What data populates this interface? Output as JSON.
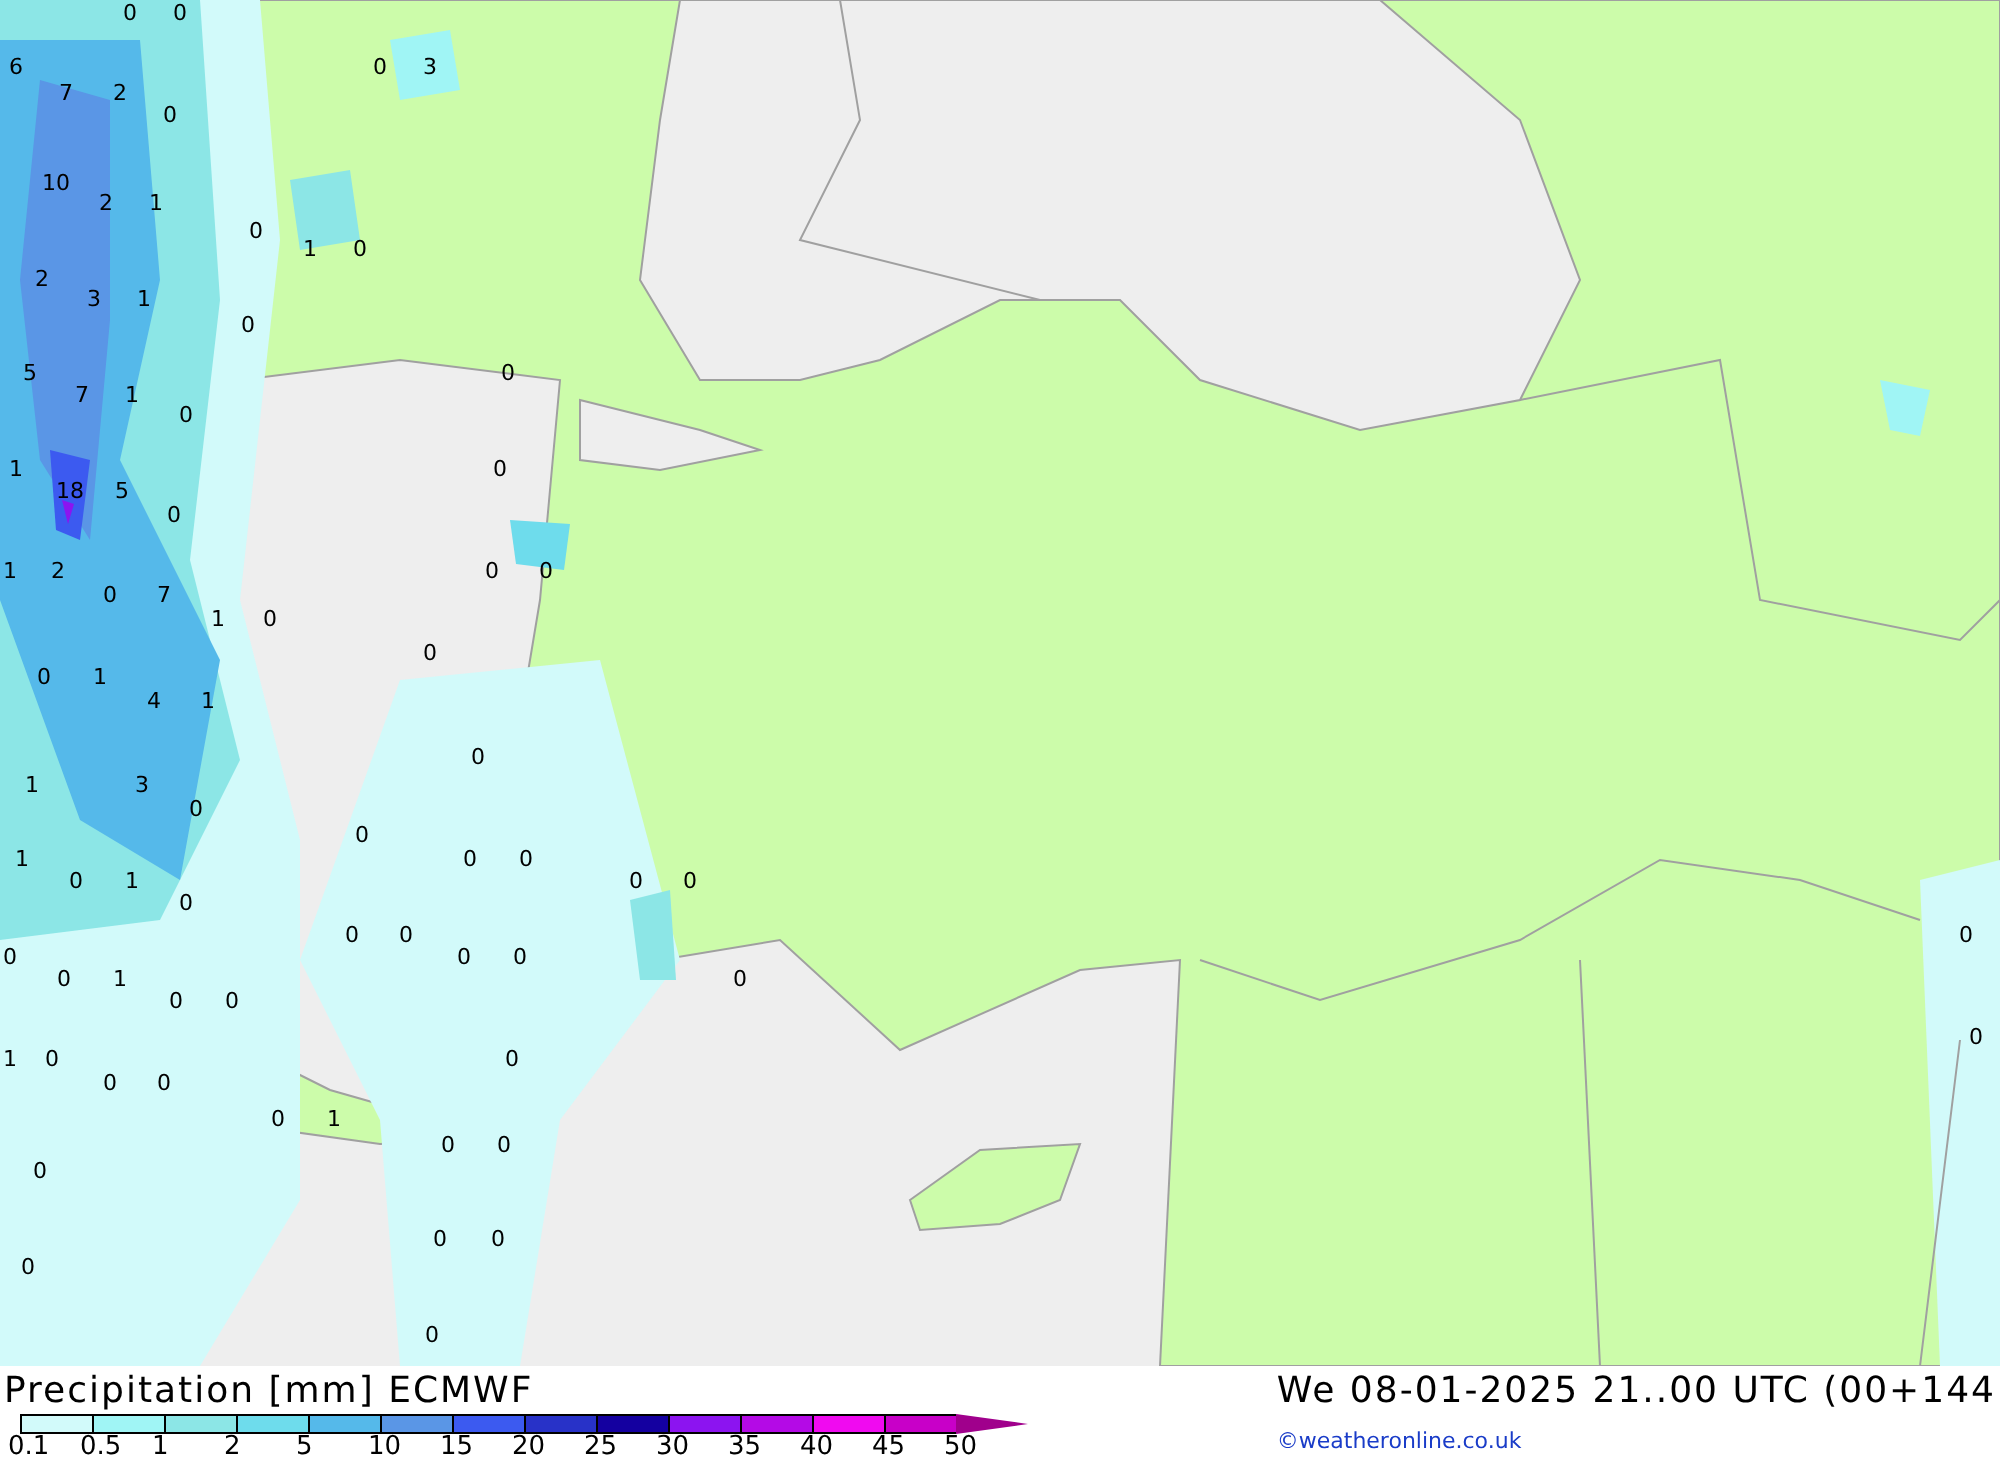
{
  "map": {
    "labels": [
      "0",
      "0",
      "6",
      "0",
      "3",
      "7",
      "2",
      "0",
      "10",
      "2",
      "1",
      "0",
      "1",
      "0",
      "2",
      "3",
      "1",
      "0",
      "5",
      "0",
      "7",
      "1",
      "0",
      "1",
      "0",
      "18",
      "5",
      "0",
      "1",
      "2",
      "0",
      "0",
      "0",
      "7",
      "1",
      "0",
      "0",
      "0",
      "1",
      "4",
      "1",
      "0",
      "1",
      "3",
      "0",
      "0",
      "1",
      "0",
      "0",
      "0",
      "1",
      "0",
      "0",
      "0",
      "0",
      "0",
      "0",
      "0",
      "0",
      "0",
      "0",
      "1",
      "0",
      "0",
      "0",
      "0",
      "1",
      "0",
      "0",
      "0",
      "0",
      "0",
      "1",
      "0",
      "0",
      "0",
      "0",
      "0",
      "0",
      "0"
    ]
  },
  "legend": {
    "title": "Precipitation [mm] ECMWF",
    "valid_time": "We 08-01-2025 21..00 UTC (00+144",
    "credit": "©weatheronline.co.uk",
    "scale": [
      {
        "label": "0.1",
        "color": "#d2fafa"
      },
      {
        "label": "0.5",
        "color": "#a0f5f5"
      },
      {
        "label": "1",
        "color": "#8ce6e6"
      },
      {
        "label": "2",
        "color": "#6edcec"
      },
      {
        "label": "5",
        "color": "#55b9ea"
      },
      {
        "label": "10",
        "color": "#5a96e6"
      },
      {
        "label": "15",
        "color": "#3c5af0"
      },
      {
        "label": "20",
        "color": "#2832c8"
      },
      {
        "label": "25",
        "color": "#1400a0"
      },
      {
        "label": "30",
        "color": "#8c14f0"
      },
      {
        "label": "35",
        "color": "#b40ae6"
      },
      {
        "label": "40",
        "color": "#f00af0"
      },
      {
        "label": "45",
        "color": "#c800c8"
      },
      {
        "label": "50",
        "color": "#a0008c"
      }
    ]
  }
}
